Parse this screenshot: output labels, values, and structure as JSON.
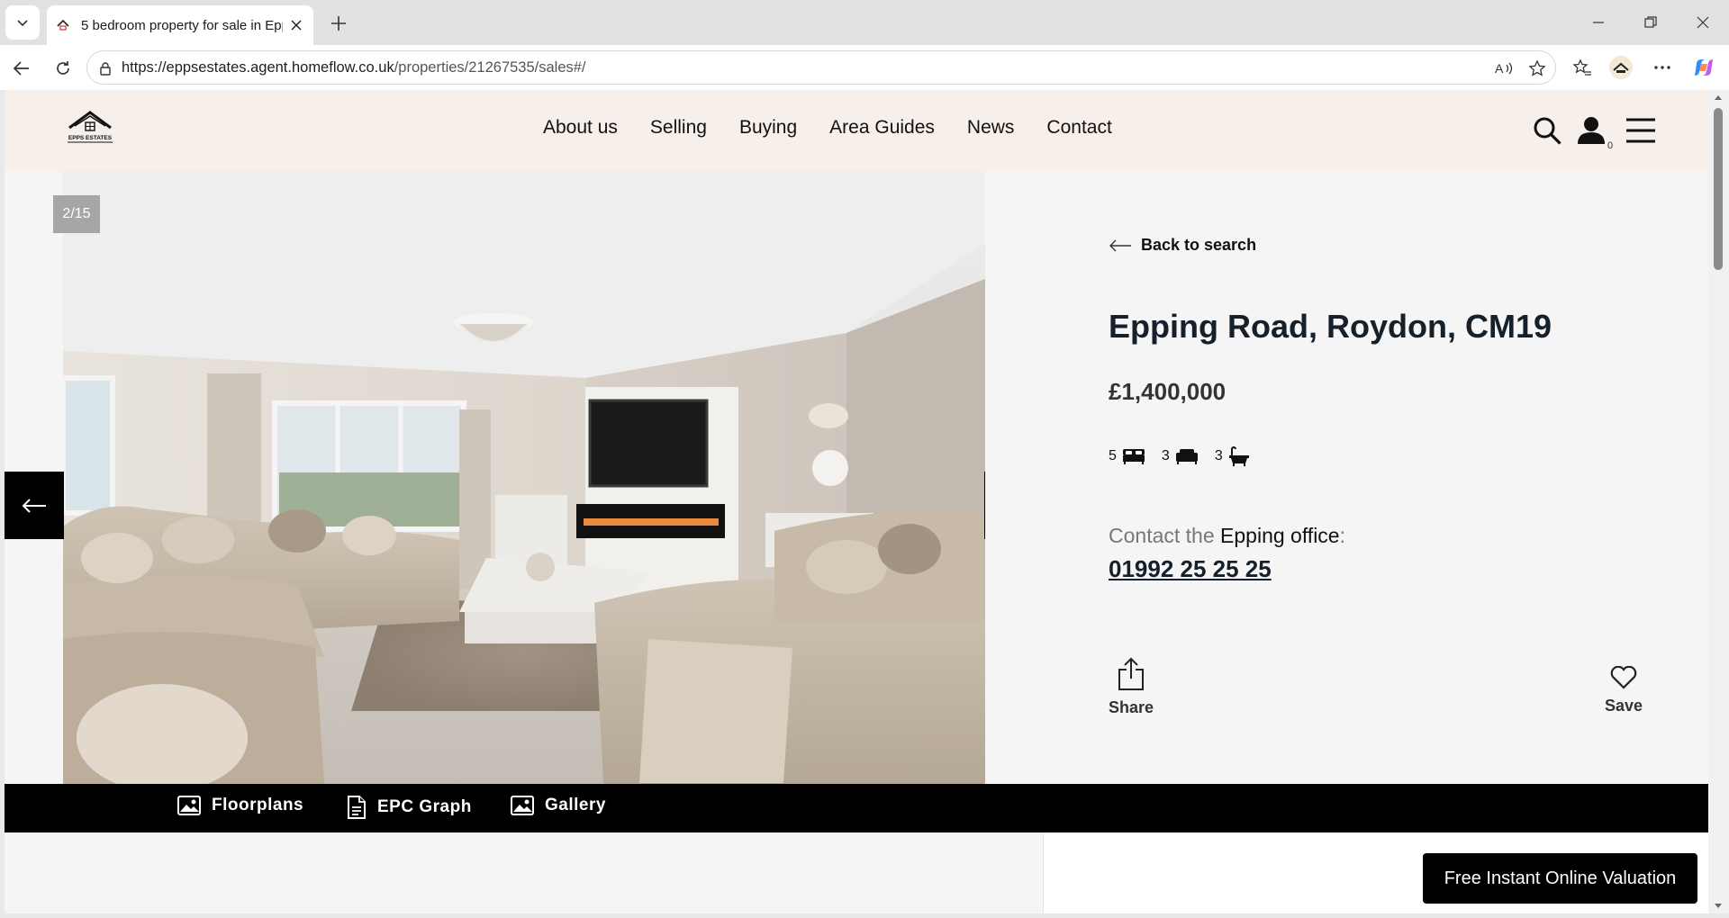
{
  "browser": {
    "tab_title": "5 bedroom property for sale in Epp",
    "url_host": "https://eppsestates.agent.homeflow.co.uk",
    "url_path": "/properties/21267535/sales#/"
  },
  "site": {
    "logo_text": "EPPS ESTATES",
    "nav": [
      "About us",
      "Selling",
      "Buying",
      "Area Guides",
      "News",
      "Contact"
    ],
    "basket_count": "0"
  },
  "gallery": {
    "counter": "2/15"
  },
  "property": {
    "back_label": "Back to search",
    "title": "Epping Road, Roydon, CM19",
    "price": "£1,400,000",
    "bedrooms": "5",
    "receptions": "3",
    "bathrooms": "3",
    "contact_prefix": "Contact the",
    "office": "Epping office",
    "contact_suffix": ":",
    "phone": "01992 25 25 25",
    "share_label": "Share",
    "save_label": "Save"
  },
  "media_bar": {
    "floorplans": "Floorplans",
    "epc": "EPC Graph",
    "gallery": "Gallery"
  },
  "cta": {
    "valuation": "Free Instant Online Valuation"
  }
}
